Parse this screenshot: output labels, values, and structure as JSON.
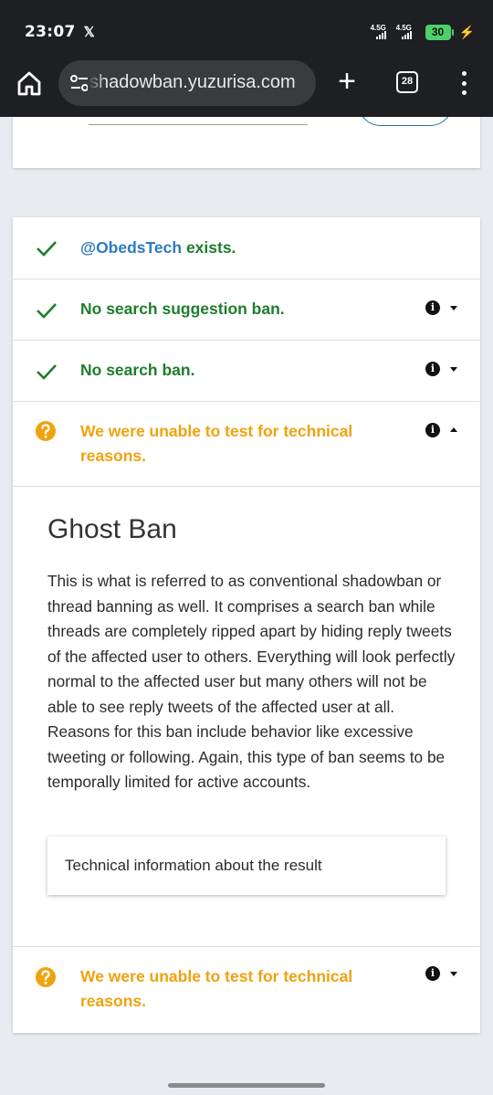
{
  "status_bar": {
    "time": "23:07",
    "x_logo": "𝕏",
    "network1": "4.5G",
    "network2": "4.5G",
    "battery": "30",
    "icons": [
      "x-logo-icon",
      "signal-icon",
      "battery-charging-icon"
    ]
  },
  "browser": {
    "url": "shadowban.yuzurisa.com",
    "tab_count": "28",
    "icons": [
      "home-icon",
      "site-settings-icon",
      "new-tab-plus-icon",
      "tabs-icon",
      "menu-icon"
    ]
  },
  "results": [
    {
      "status": "pass",
      "handle": "@ObedsTech",
      "text": " exists.",
      "icon": "check-icon",
      "color": "#1e7d2c"
    },
    {
      "status": "pass",
      "text": "No search suggestion ban.",
      "icon": "check-icon",
      "color": "#1e7d2c",
      "expandable": true
    },
    {
      "status": "pass",
      "text": "No search ban.",
      "icon": "check-icon",
      "color": "#1e7d2c",
      "expandable": true
    },
    {
      "status": "unknown",
      "text": "We were unable to test for technical reasons.",
      "icon": "question-icon",
      "color": "#f0a20e",
      "expanded": true
    },
    {
      "status": "unknown",
      "text": "We were unable to test for technical reasons.",
      "icon": "question-icon",
      "color": "#f0a20e",
      "expandable": true
    }
  ],
  "detail": {
    "title": "Ghost Ban",
    "body": "This is what is referred to as conventional shadowban or thread banning as well. It comprises a search ban while threads are completely ripped apart by hiding reply tweets of the affected user to others. Everything will look perfectly normal to the affected user but many others will not be able to see reply tweets of the affected user at all. Reasons for this ban include behavior like excessive tweeting or following. Again, this type of ban seems to be temporally limited for active accounts.",
    "tech_button": "Technical information about the result"
  },
  "colors": {
    "pass": "#1e7d2c",
    "unknown": "#f0a20e",
    "link": "#2f7bbf",
    "topbar": "#1e1f22"
  }
}
